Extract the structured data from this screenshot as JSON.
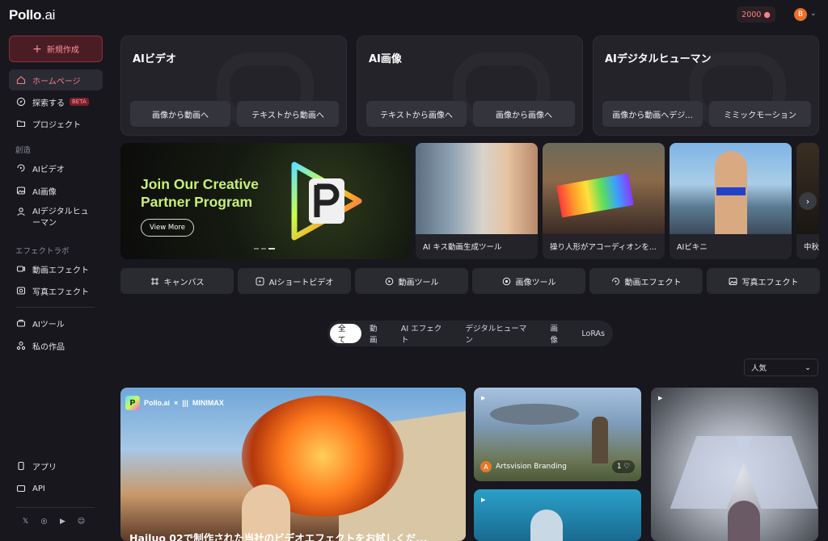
{
  "brand": {
    "logo_main": "Pollo",
    "logo_suffix": ".ai"
  },
  "sidebar": {
    "new_label": "新規作成",
    "nav": [
      {
        "label": "ホームページ",
        "icon": "home-icon",
        "active": true
      },
      {
        "label": "探索する",
        "icon": "compass-icon",
        "badge": "BETA"
      },
      {
        "label": "プロジェクト",
        "icon": "folder-icon"
      }
    ],
    "section_create": "創造",
    "create_items": [
      {
        "label": "AIビデオ",
        "icon": "video-icon"
      },
      {
        "label": "AI画像",
        "icon": "image-icon"
      },
      {
        "label": "AIデジタルヒューマン",
        "icon": "human-icon"
      }
    ],
    "section_effects": "エフェクトラボ",
    "effect_items": [
      {
        "label": "動画エフェクト",
        "icon": "video-effect-icon"
      },
      {
        "label": "写真エフェクト",
        "icon": "photo-effect-icon"
      }
    ],
    "more_items": [
      {
        "label": "AIツール",
        "icon": "toolbox-icon"
      },
      {
        "label": "私の作品",
        "icon": "works-icon"
      }
    ],
    "bottom_items": [
      {
        "label": "アプリ",
        "icon": "phone-icon"
      },
      {
        "label": "API",
        "icon": "api-icon"
      }
    ],
    "social": [
      "x-icon",
      "instagram-icon",
      "youtube-icon",
      "discord-icon"
    ]
  },
  "header": {
    "credits": "2000",
    "avatar_initial": "B"
  },
  "tool_cards": [
    {
      "title": "AIビデオ",
      "buttons": [
        "画像から動画へ",
        "テキストから動画へ"
      ]
    },
    {
      "title": "AI画像",
      "buttons": [
        "テキストから画像へ",
        "画像から画像へ"
      ]
    },
    {
      "title": "AIデジタルヒューマン",
      "buttons": [
        "画像から動画へデジ...",
        "ミミックモーション"
      ]
    }
  ],
  "hero": {
    "line1": "Join Our Creative",
    "line2": "Partner Program",
    "cta": "View More"
  },
  "features": [
    {
      "caption": "AI キス動画生成ツール"
    },
    {
      "caption": "操り人形がアコーディオンを..."
    },
    {
      "caption": "AIビキニ"
    },
    {
      "caption": "中秋"
    }
  ],
  "quick_tools": [
    {
      "label": "キャンバス",
      "icon": "canvas-icon"
    },
    {
      "label": "AIショートビデオ",
      "icon": "short-video-icon"
    },
    {
      "label": "動画ツール",
      "icon": "video-tool-icon"
    },
    {
      "label": "画像ツール",
      "icon": "image-tool-icon"
    },
    {
      "label": "動画エフェクト",
      "icon": "video-effect-icon"
    },
    {
      "label": "写真エフェクト",
      "icon": "photo-effect-icon"
    }
  ],
  "filters": [
    "全て",
    "動画",
    "AI エフェクト",
    "デジタルヒューマン",
    "画像",
    "LoRAs"
  ],
  "sort": {
    "value": "人気"
  },
  "gallery": {
    "main": {
      "brand_left": "Pollo.ai",
      "brand_x": "×",
      "brand_right": "MINIMAX",
      "caption": "Hailuo 02で制作された当社のビデオエフェクトをお試しくだ..."
    },
    "tile2": {
      "creator": "Artsvision Branding",
      "creator_initial": "A",
      "likes": "1"
    }
  },
  "colors": {
    "accent": "#ff7a86",
    "bg": "#17171d",
    "card": "#232329"
  }
}
